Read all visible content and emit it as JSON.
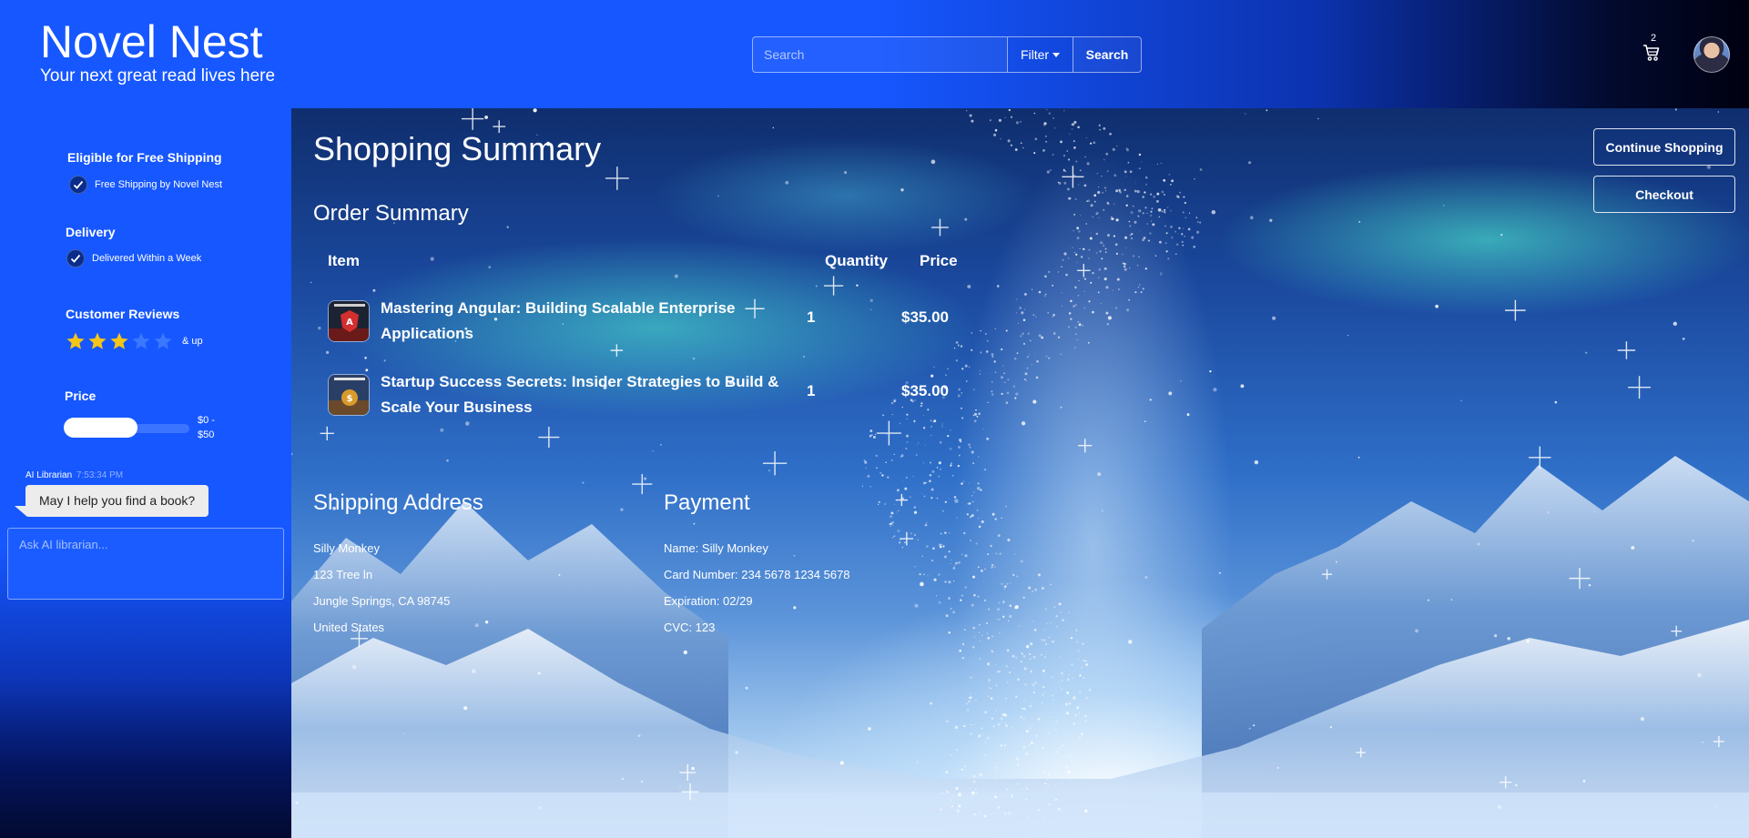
{
  "header": {
    "brand_title": "Novel Nest",
    "brand_tagline": "Your next great read lives here",
    "search_placeholder": "Search",
    "filter_label": "Filter",
    "search_button": "Search",
    "cart_count": "2"
  },
  "sidebar": {
    "free_shipping": {
      "title": "Eligible for Free Shipping",
      "option": "Free Shipping by Novel Nest",
      "checked": true
    },
    "delivery": {
      "title": "Delivery",
      "option": "Delivered Within a Week",
      "checked": true
    },
    "reviews": {
      "title": "Customer Reviews",
      "rating": 3,
      "max": 5,
      "suffix": "& up"
    },
    "price": {
      "title": "Price",
      "range_from": "$0 -",
      "range_to": "$50",
      "fill_fraction": 0.59
    },
    "chat": {
      "sender": "AI Librarian",
      "time": "7:53:34 PM",
      "message": "May I help you find a book?",
      "input_placeholder": "Ask AI librarian..."
    }
  },
  "main": {
    "page_title": "Shopping Summary",
    "order_summary_title": "Order Summary",
    "columns": {
      "item": "Item",
      "quantity": "Quantity",
      "price": "Price"
    },
    "items": [
      {
        "title": "Mastering Angular: Building Scalable Enterprise Applications",
        "quantity": "1",
        "price": "$35.00"
      },
      {
        "title": "Startup Success Secrets: Insider Strategies to Build & Scale Your Business",
        "quantity": "1",
        "price": "$35.00"
      }
    ],
    "shipping": {
      "title": "Shipping Address",
      "lines": [
        "Silly Monkey",
        "123 Tree ln",
        "Jungle Springs, CA 98745",
        "United States"
      ]
    },
    "payment": {
      "title": "Payment",
      "lines": [
        "Name: Silly Monkey",
        "Card Number: 234 5678 1234 5678",
        "Expiration: 02/29",
        "CVC: 123"
      ]
    },
    "buttons": {
      "continue": "Continue Shopping",
      "checkout": "Checkout"
    }
  },
  "colors": {
    "brand_blue": "#1657ff",
    "star_filled": "#f5c518",
    "star_empty": "#3a78ff"
  },
  "icons": [
    "cart-icon",
    "check-icon",
    "star-icon",
    "caret-down-icon",
    "avatar"
  ]
}
